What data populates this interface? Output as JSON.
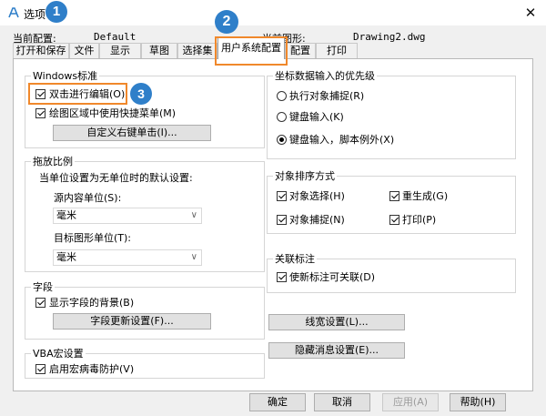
{
  "window": {
    "title": "选项",
    "close_glyph": "✕"
  },
  "badges": [
    "1",
    "2",
    "3"
  ],
  "header": {
    "current_config_label": "当前配置:",
    "current_config_value": "Default",
    "current_drawing_label": "当前图形:",
    "current_drawing_value": "Drawing2.dwg"
  },
  "tabs": [
    {
      "label": "打开和保存"
    },
    {
      "label": "文件"
    },
    {
      "label": "显示"
    },
    {
      "label": "草图"
    },
    {
      "label": "选择集"
    },
    {
      "label": "用户系统配置",
      "active": true
    },
    {
      "label": "配置"
    },
    {
      "label": "打印"
    }
  ],
  "windows_std": {
    "title": "Windows标准",
    "dblclick_edit": "双击进行编辑(O)",
    "shortcut_menu": "绘图区域中使用快捷菜单(M)",
    "right_click_button": "自定义右键单击(I)..."
  },
  "scale": {
    "title": "拖放比例",
    "desc": "当单位设置为无单位时的默认设置:",
    "source_label": "源内容单位(S):",
    "source_value": "毫米",
    "target_label": "目标图形单位(T):",
    "target_value": "毫米"
  },
  "field": {
    "title": "字段",
    "show_bg": "显示字段的背景(B)",
    "update_button": "字段更新设置(F)..."
  },
  "vba": {
    "title": "VBA宏设置",
    "enable_virus": "启用宏病毒防护(V)"
  },
  "coord": {
    "title": "坐标数据输入的优先级",
    "options": [
      "执行对象捕捉(R)",
      "键盘输入(K)",
      "键盘输入，脚本例外(X)"
    ]
  },
  "sort": {
    "title": "对象排序方式",
    "obj_select": "对象选择(H)",
    "regen": "重生成(G)",
    "osnap": "对象捕捉(N)",
    "plot": "打印(P)"
  },
  "assoc": {
    "title": "关联标注",
    "new_assoc": "使新标注可关联(D)"
  },
  "buttons": {
    "lineweight": "线宽设置(L)...",
    "hidden_msg": "隐藏消息设置(E)...",
    "ok": "确定",
    "cancel": "取消",
    "apply": "应用(A)",
    "help": "帮助(H)"
  },
  "colors": {
    "accent": "#2f7fc9",
    "highlight": "#f0882b"
  }
}
